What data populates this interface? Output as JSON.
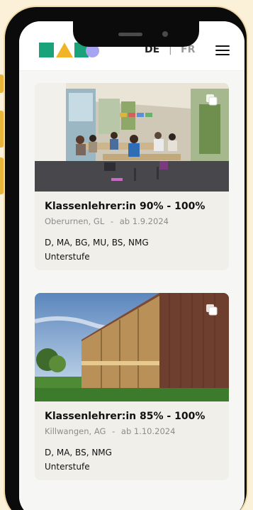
{
  "header": {
    "lang_de": "DE",
    "lang_separator": "|",
    "lang_fr": "FR"
  },
  "icons": {
    "logo": "logo-shapes",
    "menu": "hamburger-icon",
    "copy": "copy-icon"
  },
  "colors": {
    "brand_green": "#1aa37a",
    "brand_yellow": "#f0b429",
    "brand_lilac": "#a7a4f2",
    "accent_red": "#e5344a",
    "background": "#fbf1d8"
  },
  "jobs": [
    {
      "title": "Klassenlehrer:in 90% - 100%",
      "location": "Oberurnen, GL",
      "meta_separator": "-",
      "start": "ab 1.9.2024",
      "subjects": "D, MA, BG, MU, BS, NMG",
      "level": "Unterstufe"
    },
    {
      "title": "Klassenlehrer:in 85% - 100%",
      "location": "Killwangen, AG",
      "meta_separator": "-",
      "start": "ab 1.10.2024",
      "subjects": "D, MA, BS, NMG",
      "level": "Unterstufe"
    }
  ]
}
